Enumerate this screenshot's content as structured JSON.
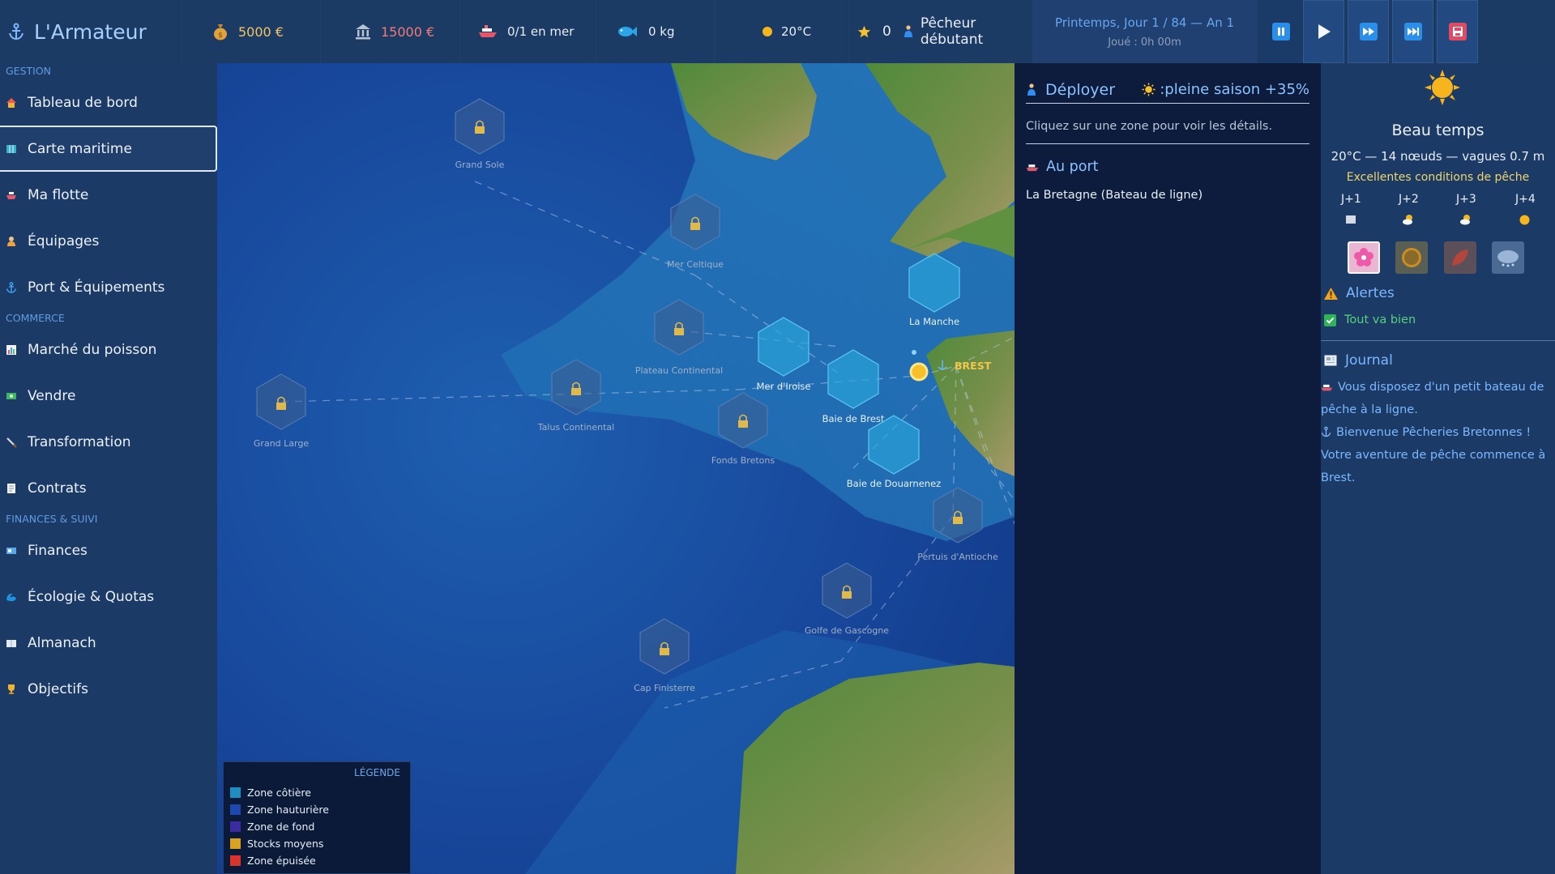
{
  "topbar": {
    "brand": "L'Armateur",
    "money": "5000 €",
    "bank": "15000 €",
    "boats": "0/1 en mer",
    "catch": "0 kg",
    "temperature": "20°C",
    "reputation": "0",
    "rank": "Pêcheur débutant",
    "date": "Printemps, Jour 1 / 84 — An 1",
    "played": "Joué : 0h 00m",
    "controls": [
      "pause-icon",
      "play-icon",
      "fast-forward-icon",
      "skip-forward-icon",
      "save-icon"
    ]
  },
  "sidebar": {
    "sections": [
      {
        "title": "GESTION",
        "items": [
          {
            "label": "Tableau de bord",
            "icon": "house-icon"
          },
          {
            "label": "Carte maritime",
            "icon": "map-icon"
          },
          {
            "label": "Ma flotte",
            "icon": "ship-icon"
          },
          {
            "label": "Équipages",
            "icon": "crew-icon"
          },
          {
            "label": "Port & Équipements",
            "icon": "anchor-icon"
          }
        ]
      },
      {
        "title": "COMMERCE",
        "items": [
          {
            "label": "Marché du poisson",
            "icon": "market-icon"
          },
          {
            "label": "Vendre",
            "icon": "cash-icon"
          },
          {
            "label": "Transformation",
            "icon": "knife-icon"
          },
          {
            "label": "Contrats",
            "icon": "contract-icon"
          }
        ]
      },
      {
        "title": "FINANCES & SUIVI",
        "items": [
          {
            "label": "Finances",
            "icon": "banknote-icon"
          },
          {
            "label": "Écologie & Quotas",
            "icon": "wave-icon"
          },
          {
            "label": "Almanach",
            "icon": "book-icon"
          },
          {
            "label": "Objectifs",
            "icon": "trophy-icon"
          }
        ]
      }
    ],
    "active": "Carte maritime"
  },
  "map": {
    "port": "BREST",
    "zones": {
      "grand_sole": "Grand Sole",
      "mer_celtique": "Mer Celtique",
      "la_manche": "La Manche",
      "plateau_continental": "Plateau Continental",
      "mer_iroise": "Mer d'Iroise",
      "baie_de_brest": "Baie de Brest",
      "grand_large": "Grand Large",
      "talus_continental": "Talus Continental",
      "fonds_bretons": "Fonds Bretons",
      "baie_de_douarnenez": "Baie de Douarnenez",
      "pertuis_antioche": "Pertuis d'Antioche",
      "golfe_de_gascogne": "Golfe de Gascogne",
      "cap_finisterre": "Cap Finisterre"
    },
    "legend": {
      "title": "LÉGENDE",
      "items": [
        {
          "label": "Zone côtière",
          "color": "#1f8fbf"
        },
        {
          "label": "Zone hauturière",
          "color": "#1d48b0"
        },
        {
          "label": "Zone de fond",
          "color": "#3b2aa0"
        },
        {
          "label": "Stocks moyens",
          "color": "#d9a21f"
        },
        {
          "label": "Zone épuisée",
          "color": "#d8342b"
        }
      ]
    }
  },
  "detail": {
    "deploy": "Déployer",
    "season": ":pleine saison +35%",
    "hint": "Cliquez sur une zone pour voir les détails.",
    "port_title": "Au port",
    "ship": "La Bretagne (Bateau de ligne)"
  },
  "weather": {
    "title": "Beau temps",
    "summary": "20°C — 14 nœuds — vagues 0.7 m",
    "conditions": "Excellentes conditions de pêche",
    "forecast": [
      {
        "day": "J+1",
        "icon": "cloud-icon"
      },
      {
        "day": "J+2",
        "icon": "sun-cloud-icon"
      },
      {
        "day": "J+3",
        "icon": "sun-cloud-icon"
      },
      {
        "day": "J+4",
        "icon": "sun-icon"
      }
    ],
    "seasons": [
      "spring-icon",
      "summer-icon",
      "autumn-icon",
      "winter-icon"
    ]
  },
  "alerts": {
    "title": "Alertes",
    "status": "Tout va bien"
  },
  "journal": {
    "title": "Journal",
    "entries": [
      "Vous disposez d'un petit bateau de pêche à la ligne.",
      "Bienvenue Pêcheries Bretonnes ! Votre aventure de pêche commence à Brest."
    ]
  },
  "colors": {
    "accent": "#7cb8ff",
    "gold": "#f3c55f",
    "danger": "#f07c77",
    "ok": "#58d07c"
  }
}
